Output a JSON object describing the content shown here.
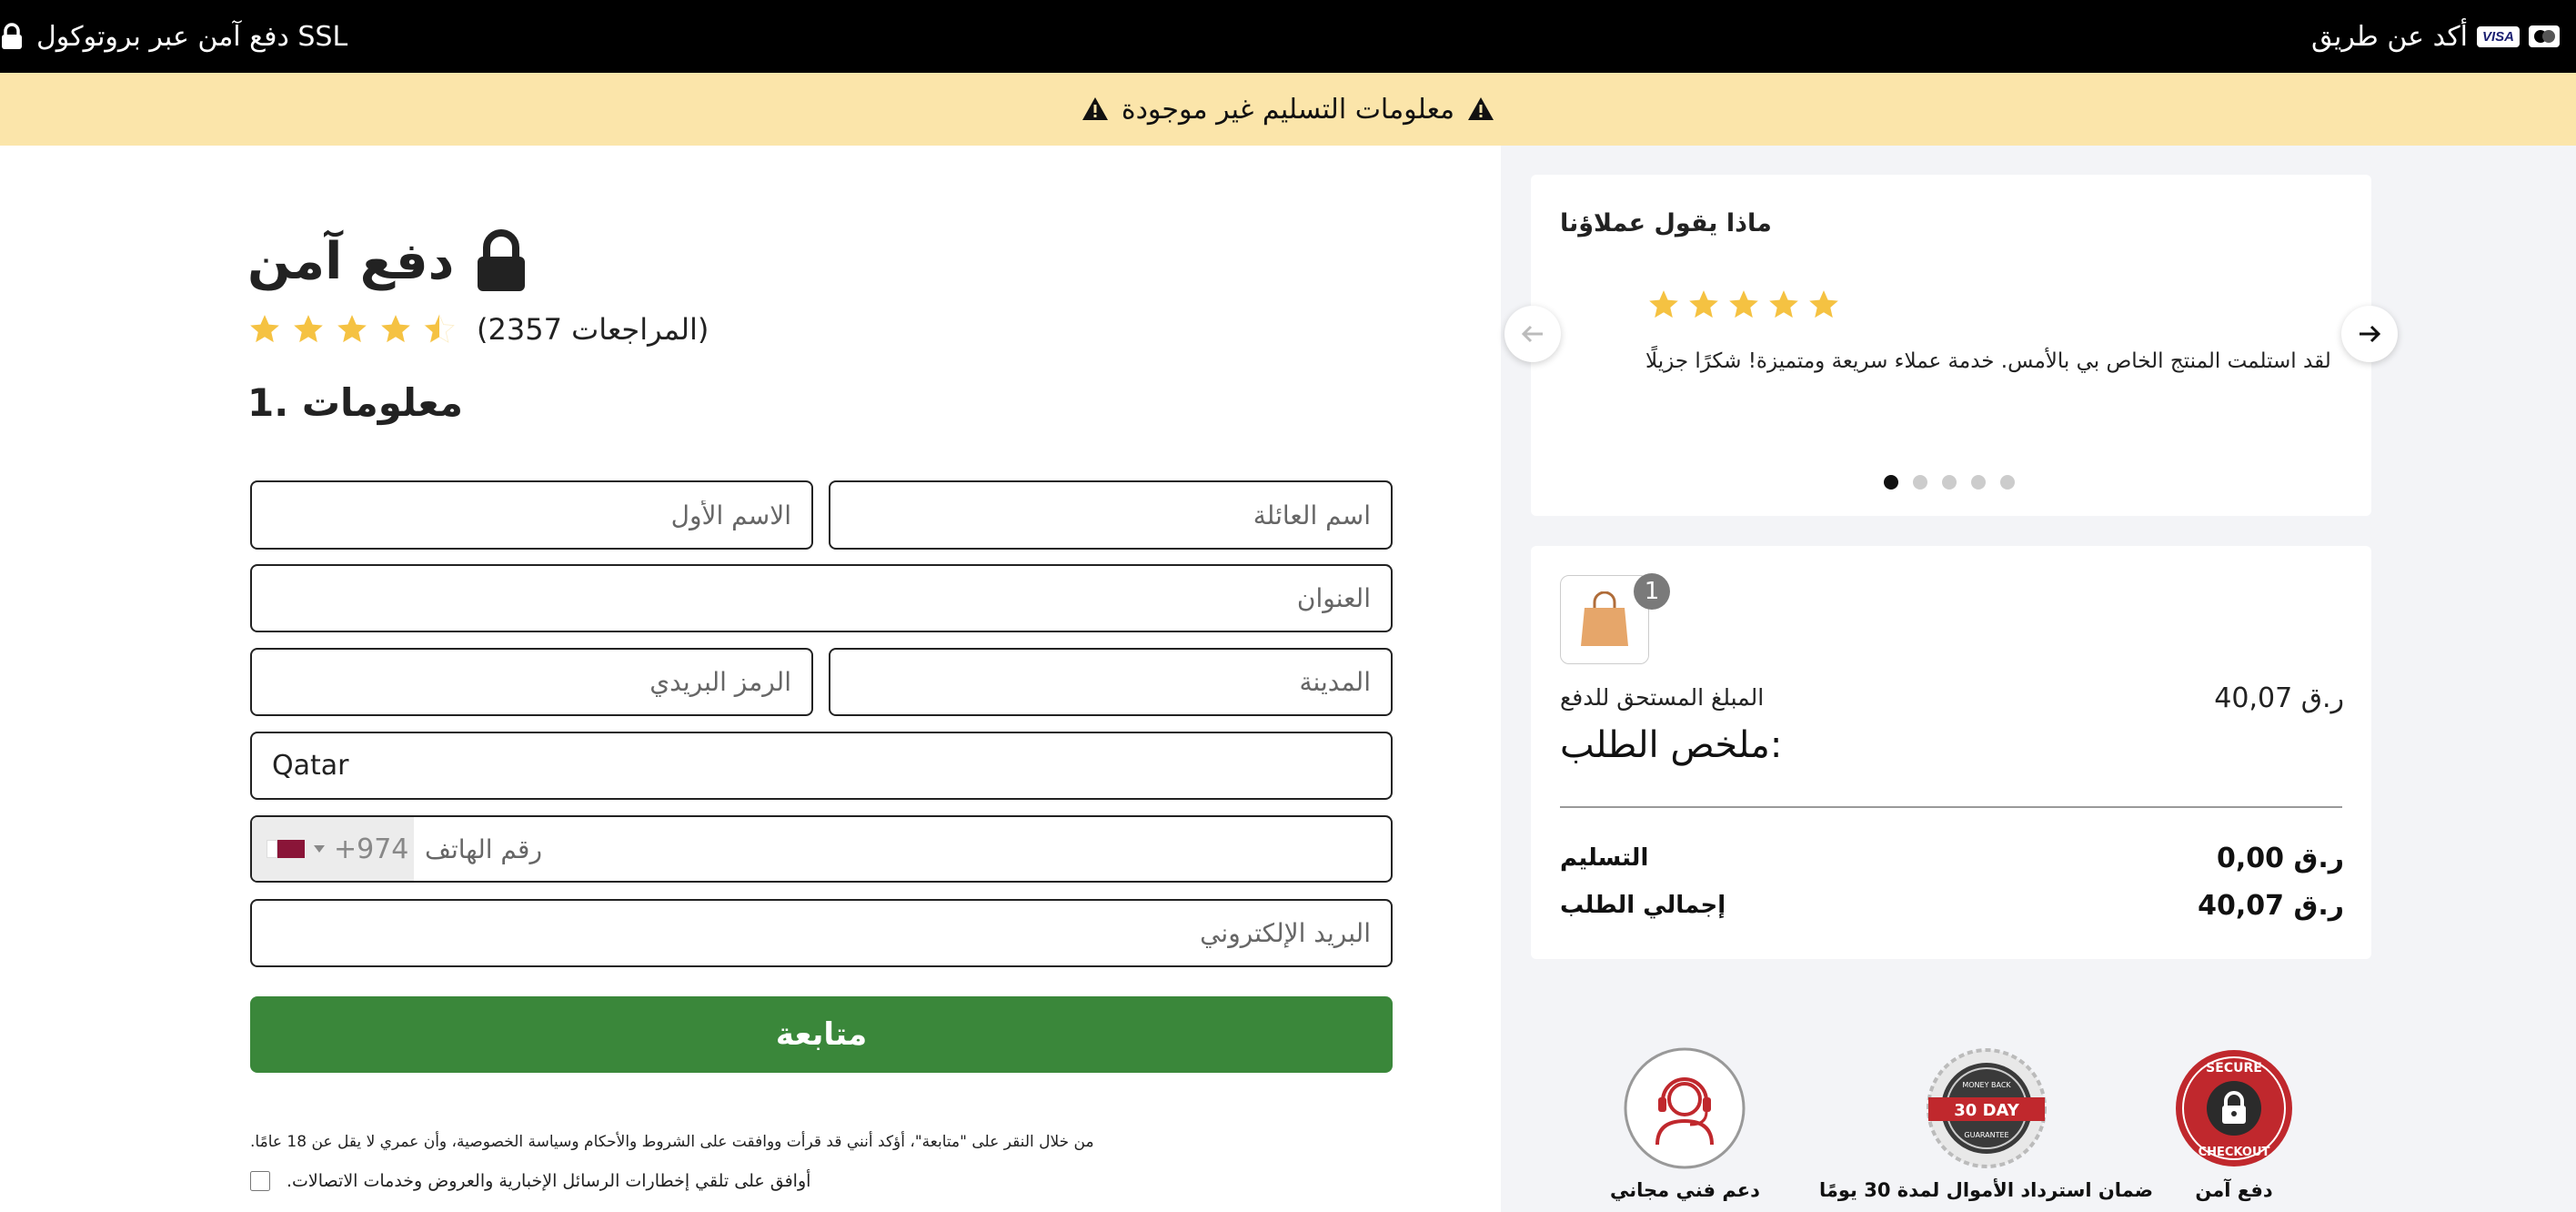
{
  "topbar": {
    "ssl_text": "دفع آمن عبر بروتوكول SSL",
    "pay_text": "أكد عن طريق",
    "card_visa": "VISA"
  },
  "alert": {
    "text": "معلومات التسليم غير موجودة"
  },
  "form": {
    "title": "دفع آمن",
    "rating_value": 4.5,
    "reviews": "(المراجعات 2357)",
    "section_heading": "1. معلومات",
    "first_name_placeholder": "الاسم الأول",
    "last_name_placeholder": "اسم العائلة",
    "address_placeholder": "العنوان",
    "postal_placeholder": "الرمز البريدي",
    "city_placeholder": "المدينة",
    "country_value": "Qatar",
    "phone_code": "+974",
    "phone_placeholder": "رقم الهاتف",
    "email_placeholder": "البريد الإلكتروني",
    "continue_label": "متابعة",
    "terms_text": ".من خلال النقر على \"متابعة\"، أؤكد أنني قد قرأت ووافقت على الشروط والأحكام وسياسة الخصوصية، وأن عمري لا يقل عن 18 عامًا",
    "consent_text": ".أوافق على تلقي إخطارات الرسائل الإخبارية والعروض وخدمات الاتصالات"
  },
  "testimonials": {
    "heading": "ماذا يقول عملاؤنا",
    "stars": 5,
    "text": "لقد استلمت المنتج الخاص بي بالأمس. خدمة عملاء سريعة ومتميزة! شكرًا جزيلًا",
    "slide_count": 5,
    "active_slide": 1
  },
  "summary": {
    "item_count": "1",
    "amount_label": "المبلغ المستحق للدفع",
    "amount_value": "ر.ق 40,07",
    "title": "ملخص الطلب:",
    "delivery_label": "التسليم",
    "delivery_value": "ر.ق 0,00",
    "total_label": "إجمالي الطلب",
    "total_value": "ر.ق 40,07"
  },
  "trust": {
    "support_label": "دعم فني مجاني",
    "refund_label": "ضمان استرداد الأموال لمدة 30 يومًا",
    "secure_label": "دفع آمن",
    "refund_badge_text": "30 DAY",
    "refund_badge_top": "MONEY BACK",
    "refund_badge_bottom": "GUARANTEE",
    "secure_badge_top": "SECURE",
    "secure_badge_bottom": "CHECKOUT"
  },
  "colors": {
    "accent_green": "#3a873a",
    "alert_bg": "#fbe5aa",
    "star": "#f5c242"
  }
}
